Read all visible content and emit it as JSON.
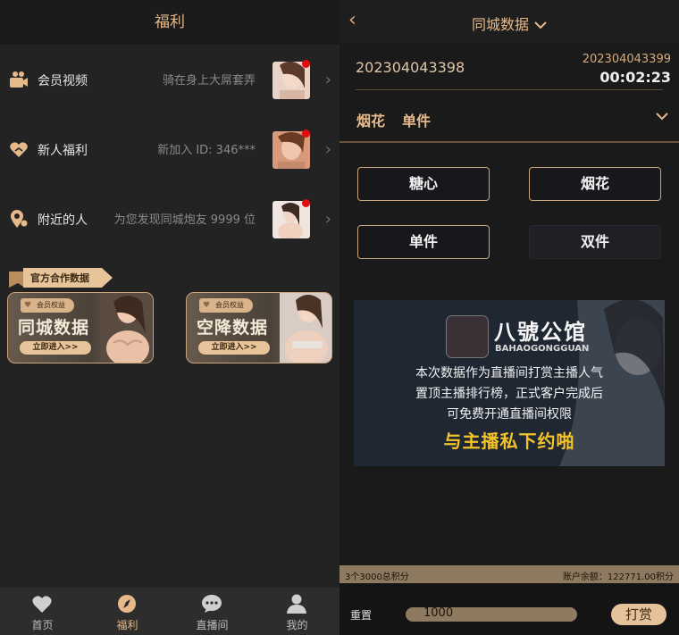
{
  "left": {
    "header_title": "福利",
    "rows": [
      {
        "title": "会员视频",
        "desc": "骑在身上大屌套弄"
      },
      {
        "title": "新人福利",
        "desc": "新加入 ID: 346***"
      },
      {
        "title": "附近的人",
        "desc": "为您发现同城炮友 9999 位"
      }
    ],
    "ribbon": "官方合作数据",
    "cards": [
      {
        "tag": "会员权益",
        "title": "同城数据",
        "cta": "立即进入>>"
      },
      {
        "tag": "会员权益",
        "title": "空降数据",
        "cta": "立即进入>>"
      }
    ],
    "tabs": [
      {
        "label": "首页",
        "icon": "heart-icon"
      },
      {
        "label": "福利",
        "icon": "compass-icon"
      },
      {
        "label": "直播间",
        "icon": "chat-icon"
      },
      {
        "label": "我的",
        "icon": "user-icon"
      }
    ],
    "active_tab": "福利"
  },
  "right": {
    "header_title": "同城数据",
    "current_period": "202304043398",
    "next_period": "202304043399",
    "countdown": "00:02:23",
    "selection": {
      "a": "烟花",
      "b": "单件"
    },
    "options": [
      "糖心",
      "烟花",
      "单件",
      "双件"
    ],
    "ad": {
      "brand": "八號公馆",
      "brand_en": "BAHAOGONGGUAN",
      "line1": "本次数据作为直播间打赏主播人气",
      "line2": "置顶主播排行榜，正式客户完成后",
      "line3": "可免费开通直播间权限",
      "highlight": "与主播私下约啪"
    },
    "summary_left": "3个3000总积分",
    "summary_right": "账户余额：122771.00积分",
    "reset_label": "重置",
    "amount": "1000",
    "tip_label": "打赏"
  },
  "colors": {
    "accent": "#e6b98a",
    "gold_bar": "#8e7a61",
    "dot": "#e10c0c",
    "highlight": "#f2c42a"
  }
}
